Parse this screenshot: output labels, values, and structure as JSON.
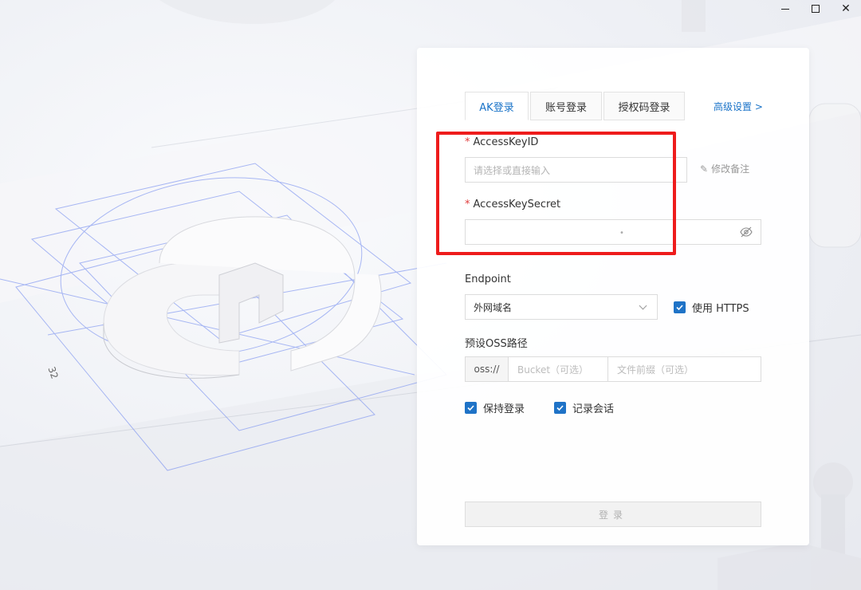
{
  "window": {
    "minimize_icon": "minimize-icon",
    "maximize_icon": "maximize-icon",
    "close_icon": "close-icon"
  },
  "background": {
    "dimension_label": "32"
  },
  "tabs": [
    {
      "label": "AK登录",
      "active": true
    },
    {
      "label": "账号登录",
      "active": false
    },
    {
      "label": "授权码登录",
      "active": false
    }
  ],
  "advanced_settings": "高级设置 >",
  "access_key_id": {
    "required_mark": "*",
    "label": "AccessKeyID",
    "placeholder": "请选择或直接输入",
    "edit_note": "修改备注"
  },
  "access_key_secret": {
    "required_mark": "*",
    "label": "AccessKeySecret",
    "value_mask": "•",
    "toggle_icon": "eye-off-icon"
  },
  "endpoint": {
    "label": "Endpoint",
    "selected": "外网域名",
    "use_https_label": "使用 HTTPS",
    "use_https_checked": true
  },
  "preset_path": {
    "label": "预设OSS路径",
    "prefix": "oss://",
    "bucket_placeholder": "Bucket（可选）",
    "folder_placeholder": "文件前缀（可选）"
  },
  "options": {
    "keep_login_label": "保持登录",
    "keep_login_checked": true,
    "record_session_label": "记录会话",
    "record_session_checked": true
  },
  "login_button": "登录",
  "colors": {
    "accent": "#1a73c8",
    "highlight": "#ee1c1c",
    "required": "#e03a3a"
  }
}
